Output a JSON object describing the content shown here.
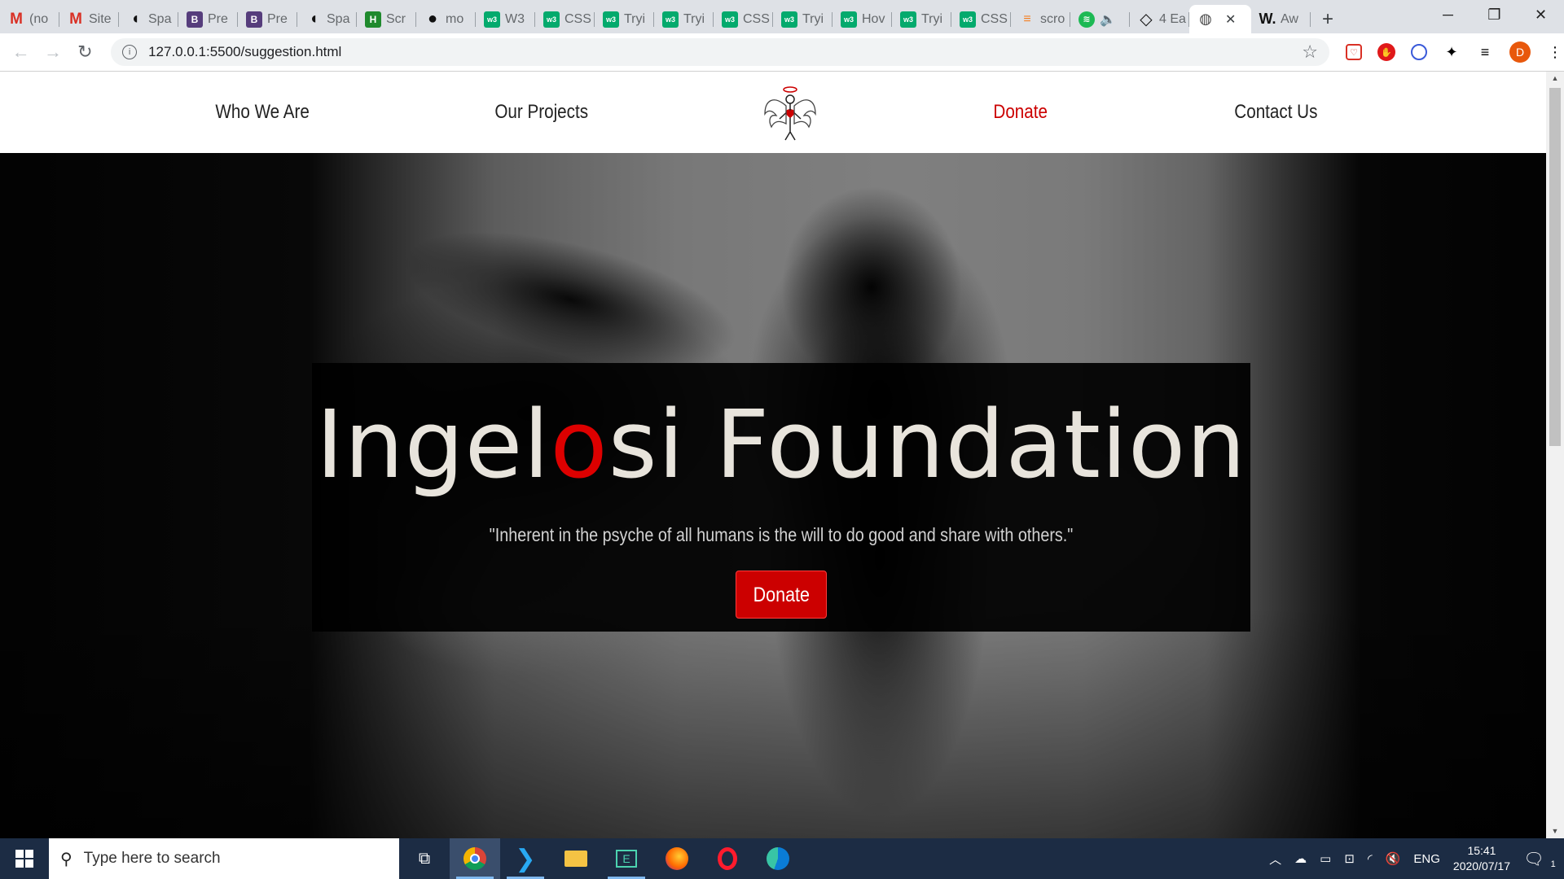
{
  "browser": {
    "tabs": [
      {
        "icon": "gmail-icon",
        "glyph": "M",
        "cls": "m",
        "title": "(no"
      },
      {
        "icon": "gmail-icon",
        "glyph": "M",
        "cls": "m",
        "title": "Site"
      },
      {
        "icon": "spa-icon",
        "glyph": "◖",
        "cls": "spa",
        "title": "Spa"
      },
      {
        "icon": "bootstrap-icon",
        "glyph": "B",
        "cls": "b",
        "title": "Pre"
      },
      {
        "icon": "bootstrap-icon",
        "glyph": "B",
        "cls": "b",
        "title": "Pre"
      },
      {
        "icon": "spa-icon",
        "glyph": "◖",
        "cls": "spa",
        "title": "Spa"
      },
      {
        "icon": "h-icon",
        "glyph": "H",
        "cls": "h",
        "title": "Scr"
      },
      {
        "icon": "github-icon",
        "glyph": "●",
        "cls": "gh",
        "title": "mo"
      },
      {
        "icon": "w3schools-icon",
        "glyph": "w3",
        "cls": "w3",
        "title": "W3"
      },
      {
        "icon": "w3schools-icon",
        "glyph": "w3",
        "cls": "w3",
        "title": "CSS"
      },
      {
        "icon": "w3schools-icon",
        "glyph": "w3",
        "cls": "w3",
        "title": "Tryi"
      },
      {
        "icon": "w3schools-icon",
        "glyph": "w3",
        "cls": "w3",
        "title": "Tryi"
      },
      {
        "icon": "w3schools-icon",
        "glyph": "w3",
        "cls": "w3",
        "title": "CSS"
      },
      {
        "icon": "w3schools-icon",
        "glyph": "w3",
        "cls": "w3",
        "title": "Tryi"
      },
      {
        "icon": "w3schools-icon",
        "glyph": "w3",
        "cls": "w3",
        "title": "Hov"
      },
      {
        "icon": "w3schools-icon",
        "glyph": "w3",
        "cls": "w3",
        "title": "Tryi"
      },
      {
        "icon": "w3schools-icon",
        "glyph": "w3",
        "cls": "w3",
        "title": "CSS"
      },
      {
        "icon": "stackoverflow-icon",
        "glyph": "≡",
        "cls": "so",
        "title": "scro"
      },
      {
        "icon": "spotify-icon",
        "glyph": "≋",
        "cls": "sp",
        "title": "🔈"
      },
      {
        "icon": "codepen-icon",
        "glyph": "◇",
        "cls": "gh",
        "title": "4 Ea"
      }
    ],
    "active_tab": {
      "icon": "globe-icon",
      "glyph": "◍",
      "close": "✕"
    },
    "last_tab": {
      "icon": "w-icon",
      "glyph": "W.",
      "title": "Aw"
    },
    "new_tab": "+",
    "window_controls": {
      "minimize": "─",
      "maximize": "❐",
      "close": "✕"
    },
    "toolbar": {
      "back": "←",
      "forward": "→",
      "reload": "↻",
      "info": "i",
      "url": "127.0.0.1:5500/suggestion.html",
      "star": "☆",
      "profile_initial": "D"
    }
  },
  "site": {
    "nav": {
      "who_we_are": "Who We Are",
      "our_projects": "Our Projects",
      "donate": "Donate",
      "contact_us": "Contact Us"
    },
    "hero": {
      "brand_part1": "Ingel",
      "brand_highlight": "o",
      "brand_part2": "si Foundation",
      "quote": "\"Inherent in the psyche of all humans is the will to do good and share with others.\"",
      "cta_label": "Donate"
    },
    "colors": {
      "accent": "#cc0000",
      "brand_text": "#e8e4dc"
    }
  },
  "taskbar": {
    "search_placeholder": "Type here to search",
    "time": "15:41",
    "date": "2020/07/17",
    "language": "ENG",
    "notification_count": "1"
  }
}
